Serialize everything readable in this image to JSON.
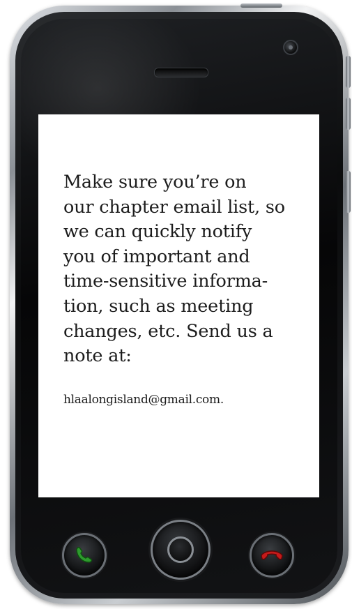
{
  "screen": {
    "message": "Make sure you’re on\nour chapter email list, so\nwe can quickly notify\nyou of important and\ntime-sensitive informa-\ntion, such as meeting\nchanges, etc. Send us a\nnote at:",
    "email": "hlaalongisland@gmail.com."
  },
  "icons": {
    "call": "phone-green-icon",
    "home": "home-circle-icon",
    "end": "phone-red-icon"
  },
  "colors": {
    "call_green": "#2e9a2e",
    "end_red": "#c61a1a",
    "screen_bg": "#ffffff",
    "text": "#1c1c1c"
  }
}
